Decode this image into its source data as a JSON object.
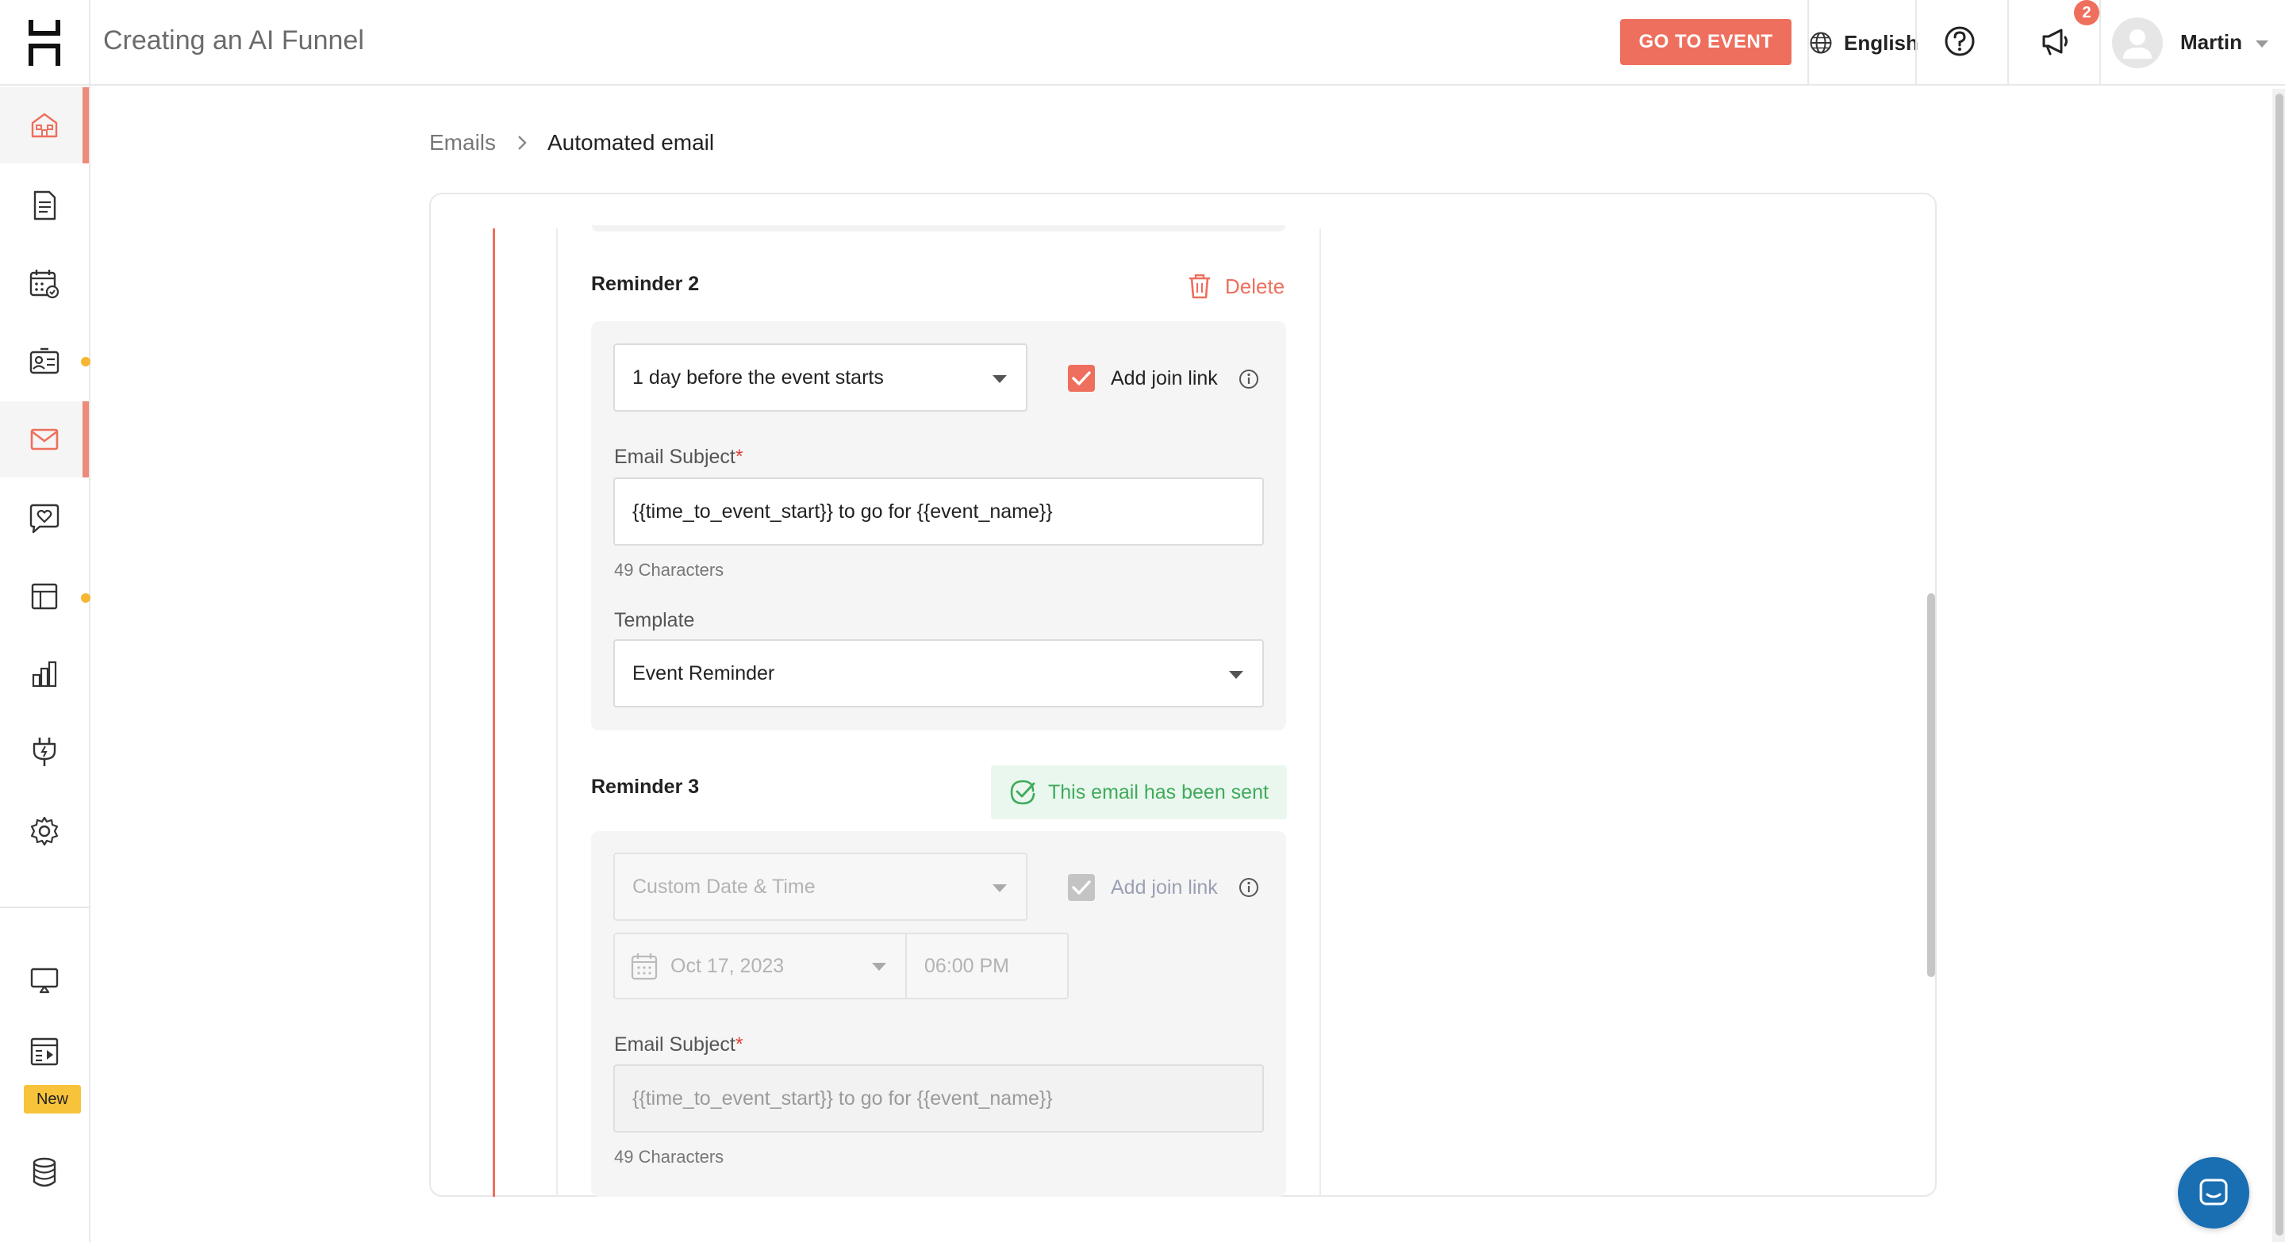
{
  "header": {
    "title": "Creating an AI Funnel",
    "go_to_event_label": "GO TO EVENT",
    "language": "English",
    "notification_count": "2",
    "user_name": "Martin"
  },
  "sidebar": {
    "items": [
      {
        "icon": "home-icon"
      },
      {
        "icon": "document-icon"
      },
      {
        "icon": "calendar-icon"
      },
      {
        "icon": "contacts-icon"
      },
      {
        "icon": "email-icon"
      },
      {
        "icon": "heart-chat-icon"
      },
      {
        "icon": "layout-icon"
      },
      {
        "icon": "analytics-icon"
      },
      {
        "icon": "plug-icon"
      },
      {
        "icon": "settings-icon"
      },
      {
        "icon": "presentation-icon"
      },
      {
        "icon": "media-layout-icon"
      },
      {
        "icon": "database-icon"
      }
    ],
    "new_badge": "New"
  },
  "breadcrumb": {
    "parent": "Emails",
    "current": "Automated email"
  },
  "reminder2": {
    "title": "Reminder 2",
    "delete_label": "Delete",
    "timing": "1 day before the event starts",
    "add_join_link_label": "Add join link",
    "add_join_link_checked": true,
    "subject_label": "Email Subject",
    "required_mark": "*",
    "subject_value": "{{time_to_event_start}} to go for {{event_name}}",
    "char_count": "49 Characters",
    "template_label": "Template",
    "template_value": "Event Reminder"
  },
  "reminder3": {
    "title": "Reminder 3",
    "sent_status": "This email has been sent",
    "timing": "Custom Date & Time",
    "add_join_link_label": "Add join link",
    "date_value": "Oct 17, 2023",
    "time_value": "06:00 PM",
    "subject_label": "Email Subject",
    "required_mark": "*",
    "subject_value": "{{time_to_event_start}} to go for {{event_name}}",
    "char_count": "49 Characters"
  },
  "colors": {
    "accent": "#ee6f5d",
    "success": "#3faa5a",
    "badge_yellow": "#f7c33a",
    "chat_blue": "#1a6fb3"
  }
}
